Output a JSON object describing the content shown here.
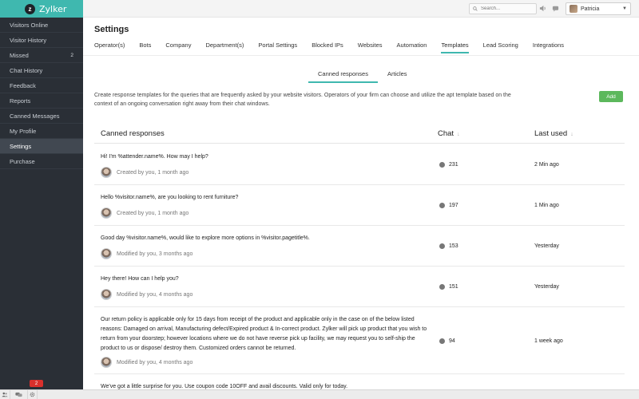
{
  "brand": {
    "logo_letter": "z",
    "name": "Zylker",
    "accent": "#3fb8af"
  },
  "sidebar": {
    "items": [
      {
        "label": "Visitors Online",
        "count": ""
      },
      {
        "label": "Visitor History",
        "count": ""
      },
      {
        "label": "Missed",
        "count": "2"
      },
      {
        "label": "Chat History",
        "count": ""
      },
      {
        "label": "Feedback",
        "count": ""
      },
      {
        "label": "Reports",
        "count": ""
      },
      {
        "label": "Canned Messages",
        "count": ""
      },
      {
        "label": "My Profile",
        "count": ""
      },
      {
        "label": "Settings",
        "count": "",
        "active": true
      },
      {
        "label": "Purchase",
        "count": ""
      }
    ]
  },
  "header": {
    "search_placeholder": "Search...",
    "user_name": "Patricia",
    "icons": [
      "search-icon",
      "sound-icon",
      "chat-status-icon",
      "user-avatar",
      "chevron-down-icon"
    ]
  },
  "page": {
    "title": "Settings",
    "tabs": [
      "Operator(s)",
      "Bots",
      "Company",
      "Department(s)",
      "Portal Settings",
      "Blocked IPs",
      "Websites",
      "Automation",
      "Templates",
      "Lead Scoring",
      "Integrations"
    ],
    "active_tab": "Templates",
    "subtabs": [
      "Canned responses",
      "Articles"
    ],
    "active_subtab": "Canned responses",
    "description": "Create response templates for the queries that are frequently asked by your website visitors. Operators of your firm can choose and utilize the apt template based on the context of an ongoing conversation right away from their chat windows.",
    "add_label": "Add"
  },
  "table": {
    "headers": {
      "response": "Canned responses",
      "chat": "Chat",
      "last_used": "Last used"
    },
    "rows": [
      {
        "text": "Hi! I'm %attender.name%. How may I help?",
        "meta": "Created by you, 1 month ago",
        "chat": "231",
        "last_used": "2 Min ago"
      },
      {
        "text": "Hello %visitor.name%, are you looking to rent furniture?",
        "meta": "Created by you, 1 month ago",
        "chat": "197",
        "last_used": "1 Min ago"
      },
      {
        "text": "Good day %visitor.name%, would like to explore more options in %visitor.pagetitle%.",
        "meta": "Modified by you, 3 months ago",
        "chat": "153",
        "last_used": "Yesterday"
      },
      {
        "text": "Hey there! How can I help you?",
        "meta": "Modified by you, 4 months ago",
        "chat": "151",
        "last_used": "Yesterday"
      },
      {
        "text": "Our return policy is applicable only for 15 days from receipt of the product and applicable only in the case on of the below listed reasons: Damaged on arrival, Manufacturing defect/Expired product & In-correct product. Zylker will pick up product that you wish to return from your doorstep; however locations where we do not have reverse pick up facility, we may request you to self-ship the product to us or dispose/ destroy them. Customized orders cannot be returned.",
        "meta": "Modified by you, 4 months ago",
        "chat": "94",
        "last_used": "1 week ago"
      },
      {
        "text": "We've got a little surprise for you. Use coupon code 10OFF and avail discounts. Valid only for today.",
        "meta": "",
        "chat": "",
        "last_used": ""
      }
    ]
  },
  "bottombar": {
    "badge": "2",
    "icons": [
      "users-icon",
      "chat-bubbles-icon",
      "settings-icon"
    ]
  }
}
